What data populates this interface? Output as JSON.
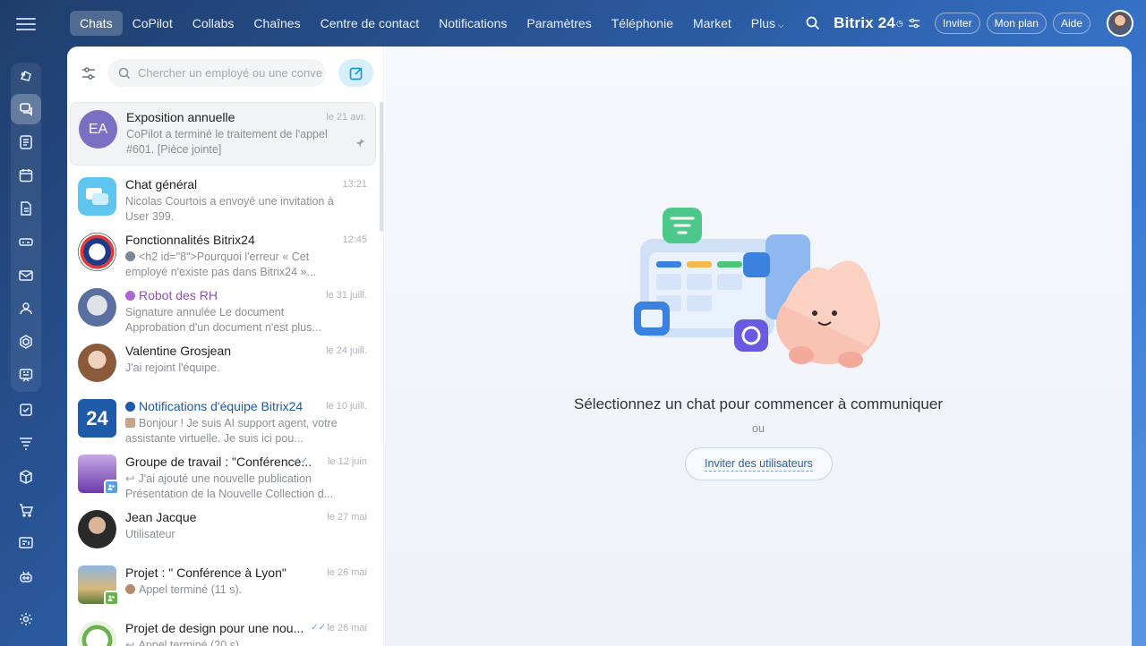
{
  "nav": {
    "tabs": [
      {
        "label": "Chats"
      },
      {
        "label": "CoPilot"
      },
      {
        "label": "Collabs"
      },
      {
        "label": "Chaînes"
      },
      {
        "label": "Centre de contact"
      },
      {
        "label": "Notifications"
      },
      {
        "label": "Paramètres"
      },
      {
        "label": "Téléphonie"
      },
      {
        "label": "Market"
      },
      {
        "label": "Plus"
      }
    ],
    "active_tab": "Chats"
  },
  "header": {
    "brand": "Bitrix 24",
    "invite_label": "Inviter",
    "plan_label": "Mon plan",
    "help_label": "Aide"
  },
  "rail": {
    "icons": [
      "menu-icon",
      "copilot-icon",
      "chats-icon",
      "feed-icon",
      "calendar-icon",
      "documents-icon",
      "drive-icon",
      "mail-icon",
      "contacts-icon",
      "crm-icon",
      "boards-icon",
      "tasks-icon",
      "sales-funnel-icon",
      "inventory-icon",
      "shop-icon",
      "sites-icon",
      "bot-icon",
      "settings-icon"
    ]
  },
  "search": {
    "placeholder": "Chercher un employé ou une conve"
  },
  "chats": [
    {
      "name": "Exposition annuelle",
      "time": "le 21 avr.",
      "preview": "CoPilot a terminé le traitement de l'appel #601. [Pièce jointe]",
      "avatar_text": "EA",
      "pinned": true
    },
    {
      "name": "Chat général",
      "time": "13:21",
      "preview": "Nicolas Courtois a envoyé une invitation à User 399."
    },
    {
      "name": "Fonctionnalités Bitrix24",
      "time": "12:45",
      "preview": "<h2 id=\"8\">Pourquoi l'erreur « Cet employé n'existe pas dans Bitrix24 »..."
    },
    {
      "name": "Robot des RH",
      "time": "le 31 juill.",
      "preview": "Signature annulée Le document Approbation d'un document n'est plus..."
    },
    {
      "name": "Valentine Grosjean",
      "time": "le 24 juill.",
      "preview": "J'ai rejoint l'équipe."
    },
    {
      "name": "Notifications d'équipe Bitrix24",
      "time": "le 10 juill.",
      "preview": "Bonjour ! Je suis AI support agent, votre assistante virtuelle. Je suis ici pou...",
      "avatar_text": "24"
    },
    {
      "name": "Groupe de travail : \"Conférence...",
      "time": "le 12 juin",
      "preview": "J'ai ajouté une nouvelle publication Présentation de la Nouvelle Collection d..."
    },
    {
      "name": "Jean Jacque",
      "time": "le 27 mai",
      "preview": "Utilisateur"
    },
    {
      "name": "Projet : \" Conférence à Lyon\"",
      "time": "le 26 mai",
      "preview": "Appel terminé (11 s)."
    },
    {
      "name": "Projet de design pour une nou...",
      "time": "le 26 mai",
      "preview": "Appel terminé (20 s)."
    }
  ],
  "empty_state": {
    "title": "Sélectionnez un chat pour commencer à communiquer",
    "or": "ou",
    "invite_label": "Inviter des utilisateurs"
  },
  "colors": {
    "accent": "#2fc6f6",
    "panel_bg": "#ffffff",
    "robot_name": "#8e52b0",
    "notif_name": "#1d5aa8"
  }
}
